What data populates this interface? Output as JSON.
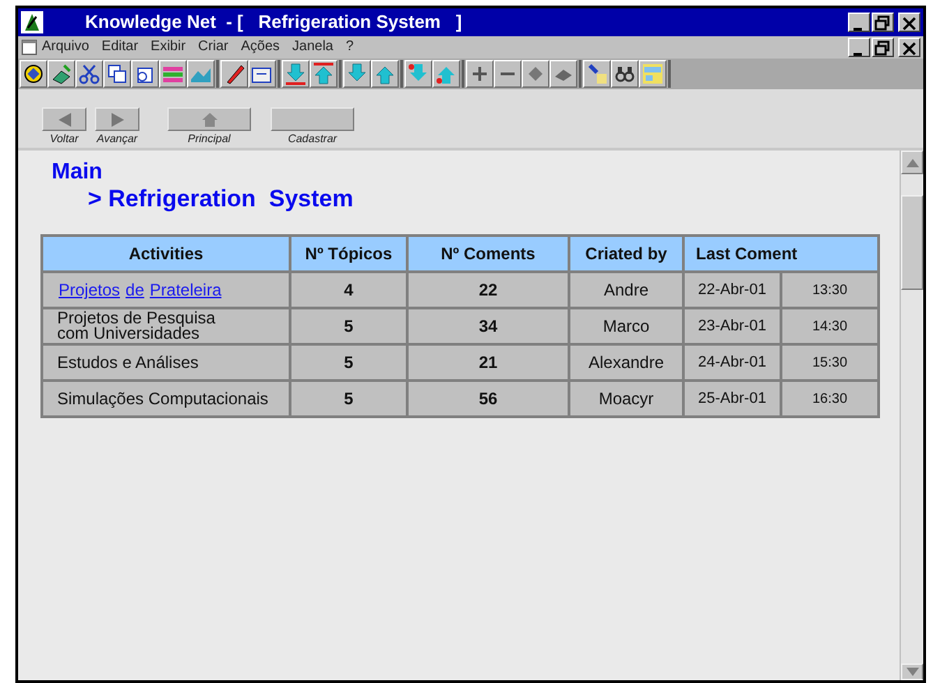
{
  "window": {
    "title": "Knowledge Net  - [   Refrigeration System   ]"
  },
  "menu": [
    "Arquivo",
    "Editar",
    "Exibir",
    "Criar",
    "Ações",
    "Janela",
    "?"
  ],
  "nav_buttons": [
    {
      "kind": "back",
      "label": "Voltar"
    },
    {
      "kind": "forward",
      "label": "Avançar"
    },
    {
      "kind": "home",
      "label": "Principal"
    },
    {
      "kind": "blank",
      "label": "Cadastrar"
    }
  ],
  "breadcrumb": {
    "root": "Main",
    "current": "> Refrigeration  System"
  },
  "table": {
    "columns": [
      "Activities",
      "Nº Tópicos",
      "Nº Coments",
      "Criated by",
      "Last Coment"
    ],
    "rows": [
      {
        "activity": {
          "kind": "link",
          "words": [
            "Projetos",
            "de",
            "Prateleira"
          ]
        },
        "topics": "4",
        "coments": "22",
        "created_by": "Andre",
        "date": "22-Abr-01",
        "time": "13:30"
      },
      {
        "activity": {
          "kind": "text",
          "lines": [
            "Projetos de Pesquisa",
            "com Universidades"
          ]
        },
        "topics": "5",
        "coments": "34",
        "created_by": "Marco",
        "date": "23-Abr-01",
        "time": "14:30"
      },
      {
        "activity": {
          "kind": "text",
          "lines": [
            "Estudos e Análises"
          ]
        },
        "topics": "5",
        "coments": "21",
        "created_by": "Alexandre",
        "date": "24-Abr-01",
        "time": "15:30"
      },
      {
        "activity": {
          "kind": "text",
          "lines": [
            "Simulações Computacionais"
          ]
        },
        "topics": "5",
        "coments": "56",
        "created_by": "Moacyr",
        "date": "25-Abr-01",
        "time": "16:30"
      }
    ]
  }
}
